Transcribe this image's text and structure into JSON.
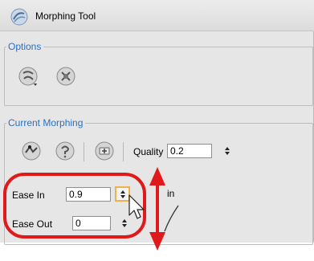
{
  "header": {
    "title": "Morphing Tool",
    "icon": "morphing-tool-icon"
  },
  "options": {
    "legend": "Options",
    "buttons": [
      {
        "name": "morphing-mode-icon"
      },
      {
        "name": "morphing-settings-icon"
      }
    ]
  },
  "current_morphing": {
    "legend": "Current Morphing",
    "buttons": [
      {
        "name": "morph-key-icon"
      },
      {
        "name": "morph-hint-icon"
      },
      {
        "name": "morph-add-icon"
      }
    ],
    "quality": {
      "label": "Quality",
      "value": "0.2"
    },
    "ease_in": {
      "label": "Ease In",
      "value": "0.9"
    },
    "ease_out": {
      "label": "Ease Out",
      "value": "0"
    },
    "partial_label": "in"
  },
  "colors": {
    "accent": "#2a6fc4",
    "annotation": "#e01a1a",
    "highlight": "#f0b04a"
  }
}
